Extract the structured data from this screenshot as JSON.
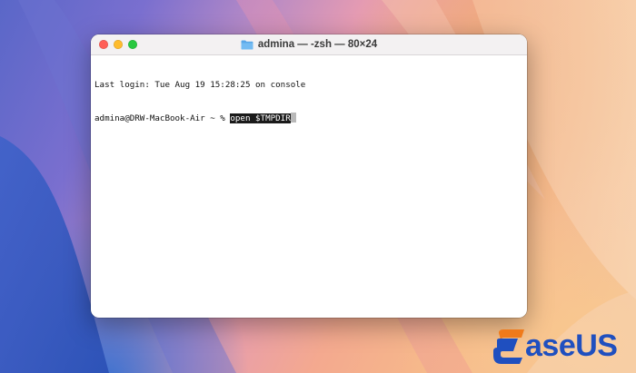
{
  "window": {
    "title": "admina — -zsh — 80×24",
    "title_icon": "folder-icon"
  },
  "terminal": {
    "line1": "Last login: Tue Aug 19 15:28:25 on console",
    "prompt": "admina@DRW-MacBook-Air ~ % ",
    "command": "open $TMPDIR"
  },
  "logo": {
    "text": "aseUS"
  },
  "colors": {
    "close": "#ff5f57",
    "minimize": "#febc2e",
    "zoom": "#28c840",
    "logo_blue": "#1f4fbf",
    "logo_orange": "#f07a1a"
  }
}
